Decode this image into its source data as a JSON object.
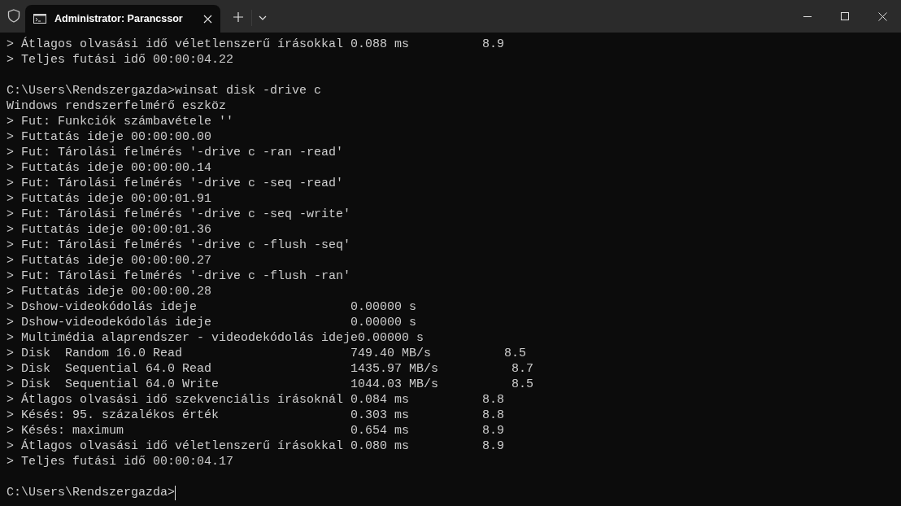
{
  "tab": {
    "title": "Administrator: Parancssor",
    "selected": true
  },
  "console": {
    "blocks": [
      [
        "> Átlagos olvasási idő véletlenszerű írásokkal 0.088 ms          8.9",
        "> Teljes futási idő 00:00:04.22"
      ],
      [
        "C:\\Users\\Rendszergazda>winsat disk -drive c",
        "Windows rendszerfelmérő eszköz",
        "> Fut: Funkciók számbavétele ''",
        "> Futtatás ideje 00:00:00.00",
        "> Fut: Tárolási felmérés '-drive c -ran -read'",
        "> Futtatás ideje 00:00:00.14",
        "> Fut: Tárolási felmérés '-drive c -seq -read'",
        "> Futtatás ideje 00:00:01.91",
        "> Fut: Tárolási felmérés '-drive c -seq -write'",
        "> Futtatás ideje 00:00:01.36",
        "> Fut: Tárolási felmérés '-drive c -flush -seq'",
        "> Futtatás ideje 00:00:00.27",
        "> Fut: Tárolási felmérés '-drive c -flush -ran'",
        "> Futtatás ideje 00:00:00.28",
        "> Dshow-videokódolás ideje                     0.00000 s",
        "> Dshow-videodekódolás ideje                   0.00000 s",
        "> Multimédia alaprendszer - videodekódolás ideje0.00000 s",
        "> Disk  Random 16.0 Read                       749.40 MB/s          8.5",
        "> Disk  Sequential 64.0 Read                   1435.97 MB/s          8.7",
        "> Disk  Sequential 64.0 Write                  1044.03 MB/s          8.5",
        "> Átlagos olvasási idő szekvenciális írásoknál 0.084 ms          8.8",
        "> Késés: 95. százalékos érték                  0.303 ms          8.8",
        "> Késés: maximum                               0.654 ms          8.9",
        "> Átlagos olvasási idő véletlenszerű írásokkal 0.080 ms          8.9",
        "> Teljes futási idő 00:00:04.17"
      ]
    ],
    "prompt": {
      "text": "C:\\Users\\Rendszergazda>",
      "cursor": true
    }
  }
}
